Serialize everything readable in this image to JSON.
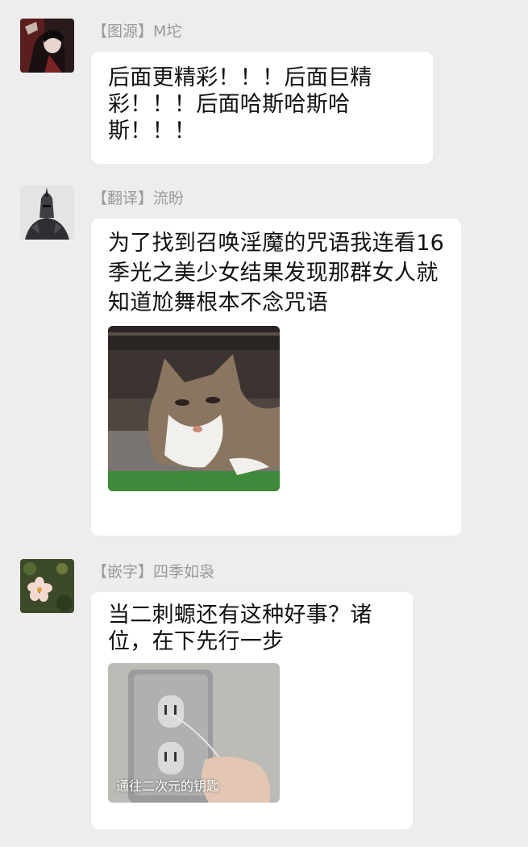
{
  "colors": {
    "background": "#ededed",
    "bubble": "#ffffff",
    "sender_name": "#9a9a9a",
    "message_text": "#111111"
  },
  "messages": [
    {
      "sender": "【图源】M坨",
      "text": "后面更精彩！！！后面巨精彩！！！后面哈斯哈斯哈斯！！！",
      "avatar_icon": "anime-character-avatar-icon"
    },
    {
      "sender": "【翻译】流盼",
      "text": "为了找到召唤淫魔的咒语我连看16季光之美少女结果发现那群女人就知道尬舞根本不念咒语",
      "avatar_icon": "dark-knight-avatar-icon",
      "image": {
        "description_icon": "cat-meme-icon"
      }
    },
    {
      "sender": "【嵌字】四季如袅",
      "text": "当二刺螈还有这种好事？诸位，在下先行一步",
      "avatar_icon": "flower-avatar-icon",
      "image": {
        "description_icon": "power-outlet-meme-icon",
        "caption": "通往二次元的钥匙"
      }
    }
  ]
}
